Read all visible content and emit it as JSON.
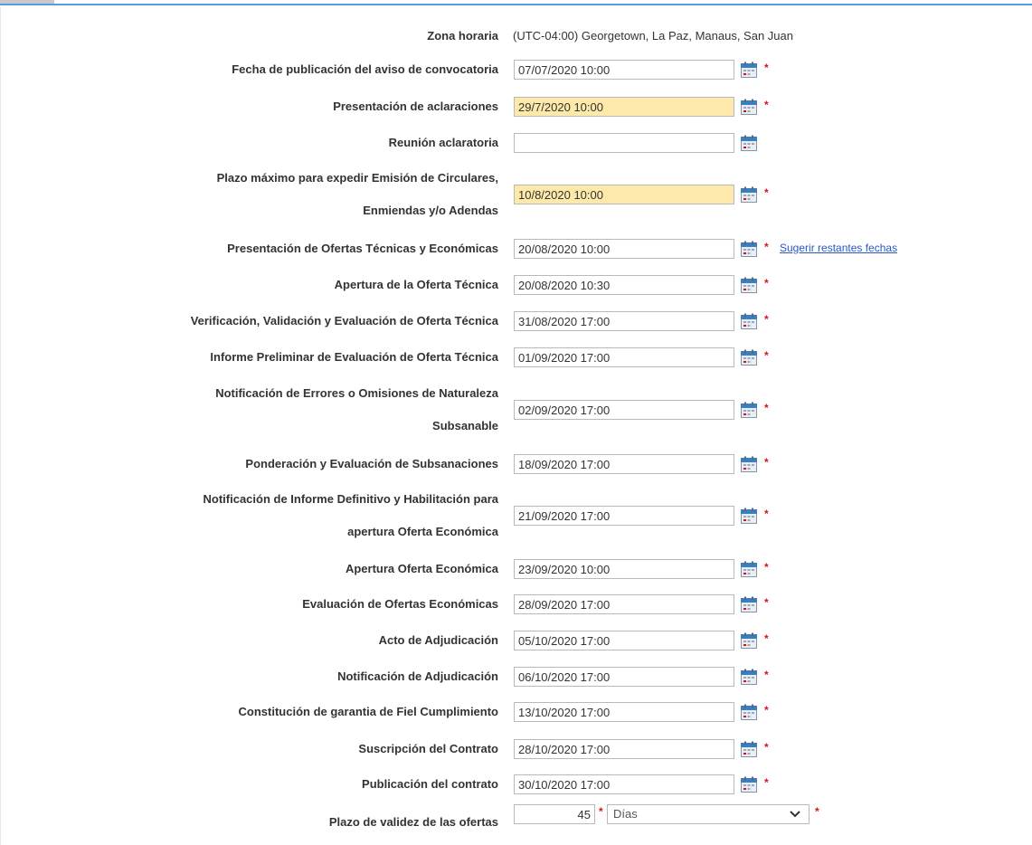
{
  "timezone": {
    "label": "Zona horaria",
    "value": "(UTC-04:00) Georgetown, La Paz, Manaus, San Juan"
  },
  "fields": [
    {
      "label_lines": [
        "Fecha de publicación del aviso de convocatoria"
      ],
      "value": "07/07/2020 10:00",
      "highlight": false,
      "required": true
    },
    {
      "label_lines": [
        "Presentación de aclaraciones"
      ],
      "value": "29/7/2020 10:00",
      "highlight": true,
      "required": true
    },
    {
      "label_lines": [
        "Reunión aclaratoria"
      ],
      "value": "",
      "highlight": false,
      "required": false
    },
    {
      "label_lines": [
        "Plazo máximo para expedir Emisión de Circulares,",
        "Enmiendas y/o Adendas"
      ],
      "value": "10/8/2020 10:00",
      "highlight": true,
      "required": true
    },
    {
      "label_lines": [
        "Presentación de Ofertas Técnicas y Económicas"
      ],
      "value": "20/08/2020 10:00",
      "highlight": false,
      "required": true,
      "link": "Sugerir restantes fechas"
    },
    {
      "label_lines": [
        "Apertura de la Oferta Técnica"
      ],
      "value": "20/08/2020 10:30",
      "highlight": false,
      "required": true
    },
    {
      "label_lines": [
        "Verificación, Validación y Evaluación de Oferta Técnica"
      ],
      "value": "31/08/2020 17:00",
      "highlight": false,
      "required": true
    },
    {
      "label_lines": [
        "Informe Preliminar de Evaluación de Oferta Técnica"
      ],
      "value": "01/09/2020 17:00",
      "highlight": false,
      "required": true
    },
    {
      "label_lines": [
        "Notificación de Errores o Omisiones de Naturaleza",
        "Subsanable"
      ],
      "value": "02/09/2020 17:00",
      "highlight": false,
      "required": true
    },
    {
      "label_lines": [
        "Ponderación y Evaluación de Subsanaciones"
      ],
      "value": "18/09/2020 17:00",
      "highlight": false,
      "required": true
    },
    {
      "label_lines": [
        "Notificación de Informe Definitivo y Habilitación para",
        "apertura Oferta Económica"
      ],
      "value": "21/09/2020 17:00",
      "highlight": false,
      "required": true
    },
    {
      "label_lines": [
        "Apertura Oferta Económica"
      ],
      "value": "23/09/2020 10:00",
      "highlight": false,
      "required": true
    },
    {
      "label_lines": [
        "Evaluación de Ofertas Económicas"
      ],
      "value": "28/09/2020 17:00",
      "highlight": false,
      "required": true
    },
    {
      "label_lines": [
        "Acto de Adjudicación"
      ],
      "value": "05/10/2020 17:00",
      "highlight": false,
      "required": true
    },
    {
      "label_lines": [
        "Notificación de Adjudicación"
      ],
      "value": "06/10/2020 17:00",
      "highlight": false,
      "required": true
    },
    {
      "label_lines": [
        "Constitución de garantia de Fiel Cumplimiento"
      ],
      "value": "13/10/2020 17:00",
      "highlight": false,
      "required": true
    },
    {
      "label_lines": [
        "Suscripción del Contrato"
      ],
      "value": "28/10/2020 17:00",
      "highlight": false,
      "required": true
    },
    {
      "label_lines": [
        "Publicación del contrato"
      ],
      "value": "30/10/2020 17:00",
      "highlight": false,
      "required": true
    }
  ],
  "validity": {
    "label": "Plazo de validez de las ofertas",
    "value": "45",
    "unit_selected": "Días"
  },
  "required_mark": "*",
  "icons": {
    "calendar": "calendar-icon",
    "dropdown": "chevron-down-icon"
  },
  "colors": {
    "highlight": "#fde9a9",
    "required": "#d2141e",
    "link": "#2b57c6",
    "top_border": "#5b9bd5"
  }
}
